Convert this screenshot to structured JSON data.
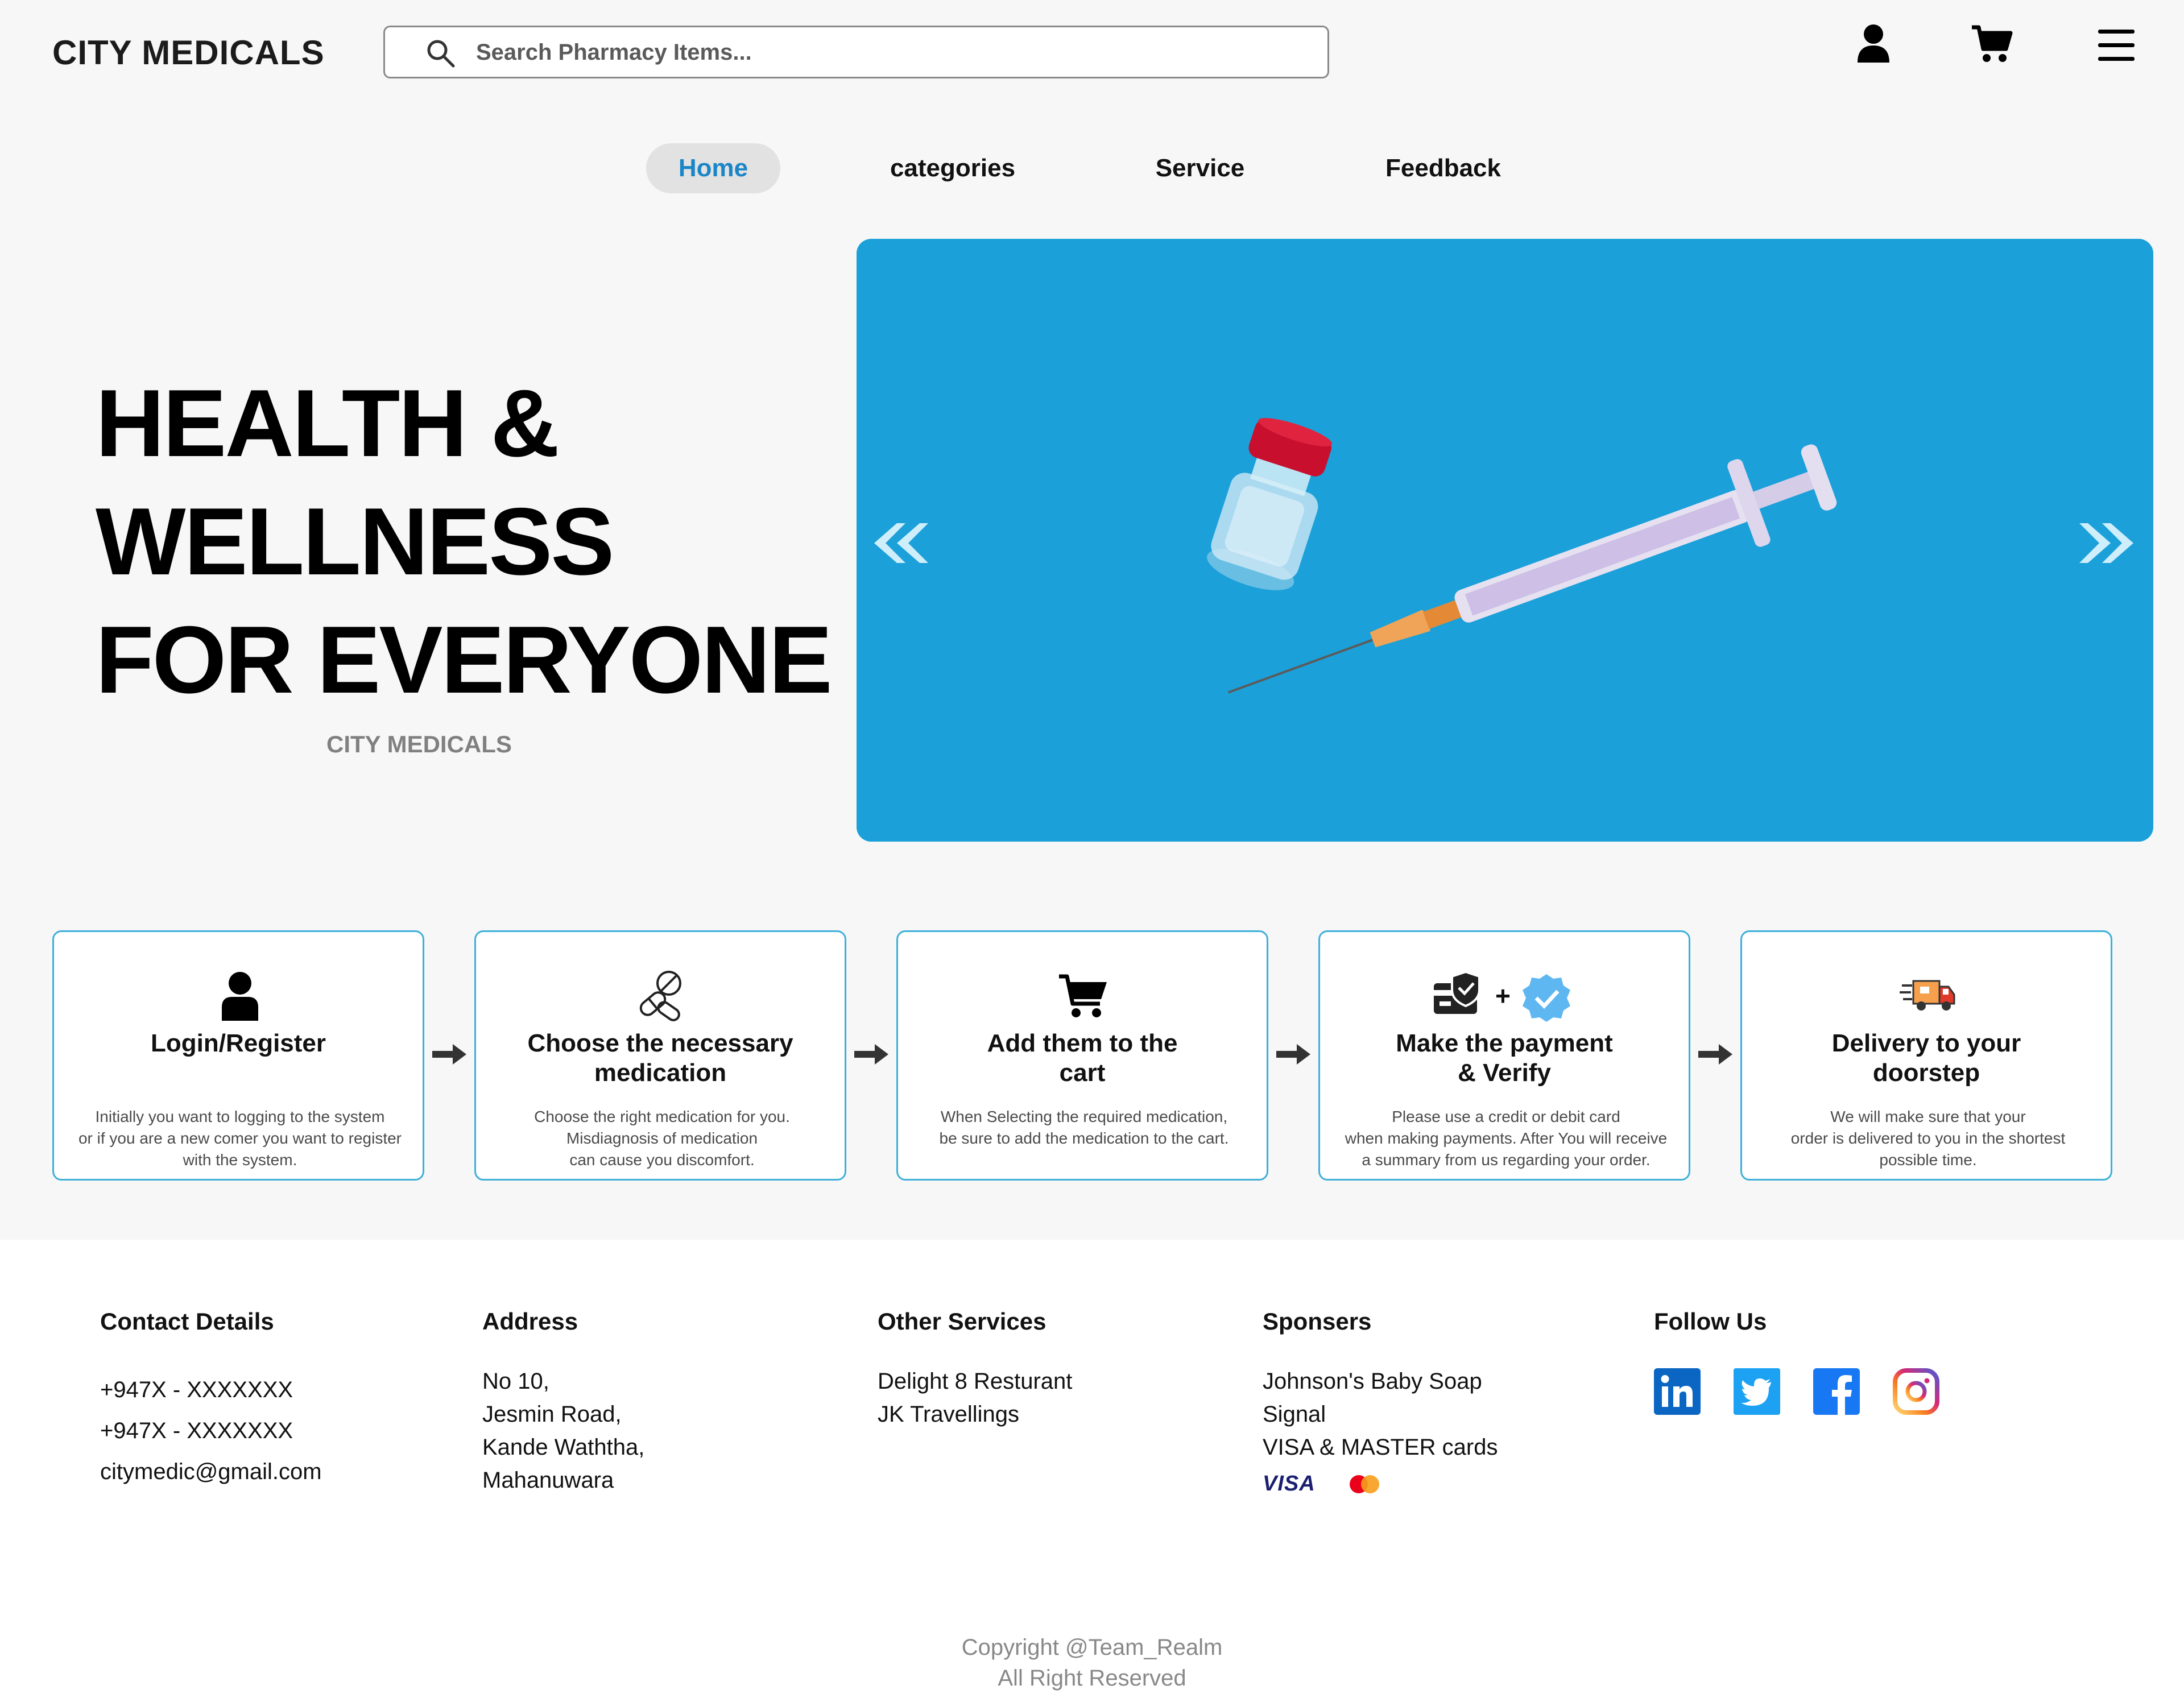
{
  "header": {
    "logo": "CITY MEDICALS",
    "search_placeholder": "Search Pharmacy Items..."
  },
  "nav": {
    "home": "Home",
    "categories": "categories",
    "service": "Service",
    "feedback": "Feedback"
  },
  "hero": {
    "line1": "HEALTH &",
    "line2": "WELLNESS",
    "line3": "FOR EVERYONE",
    "subtitle": "CITY MEDICALS"
  },
  "steps": [
    {
      "title_lines": [
        "Login/Register"
      ],
      "desc_lines": [
        "Initially you want to logging to the system",
        "or if you are a new comer you want to register",
        "with the system."
      ]
    },
    {
      "title_lines": [
        "Choose the necessary",
        "medication"
      ],
      "desc_lines": [
        "Choose the right medication for you.",
        "Misdiagnosis of medication",
        "can cause you discomfort."
      ]
    },
    {
      "title_lines": [
        "Add them to the",
        "cart"
      ],
      "desc_lines": [
        "When Selecting the required medication,",
        "be sure to add the medication to the cart."
      ]
    },
    {
      "title_lines": [
        "Make the payment",
        "& Verify"
      ],
      "desc_lines": [
        "Please use a credit or debit card",
        "when making payments. After You will receive",
        "a summary from us regarding your order."
      ]
    },
    {
      "title_lines": [
        "Delivery to your",
        "doorstep"
      ],
      "desc_lines": [
        "We will make sure that your",
        "order is delivered to you in the shortest",
        "possible time."
      ]
    }
  ],
  "step_payment_plus": "+",
  "footer": {
    "contact": {
      "title": "Contact Details",
      "lines": [
        "+947X - XXXXXXX",
        "+947X - XXXXXXX",
        "citymedic@gmail.com"
      ]
    },
    "address": {
      "title": "Address",
      "lines": [
        "No 10,",
        "Jesmin Road,",
        "Kande Waththa,",
        "Mahanuwara"
      ]
    },
    "other": {
      "title": "Other Services",
      "lines": [
        "Delight 8 Resturant",
        "JK Travellings"
      ]
    },
    "sponsors": {
      "title": "Sponsers",
      "lines": [
        "Johnson's Baby Soap",
        "Signal",
        "VISA & MASTER cards"
      ],
      "visa_logo": "VISA"
    },
    "follow": {
      "title": "Follow Us",
      "networks": [
        "linkedin-icon",
        "twitter-icon",
        "facebook-icon",
        "instagram-icon"
      ]
    },
    "copyright_1": "Copyright @Team_Realm",
    "copyright_2": "All Right Reserved"
  },
  "colors": {
    "accent_blue": "#1a86c7",
    "banner_blue": "#1ba0d9",
    "card_border": "#3fb0d9",
    "muted_text": "#808080"
  }
}
